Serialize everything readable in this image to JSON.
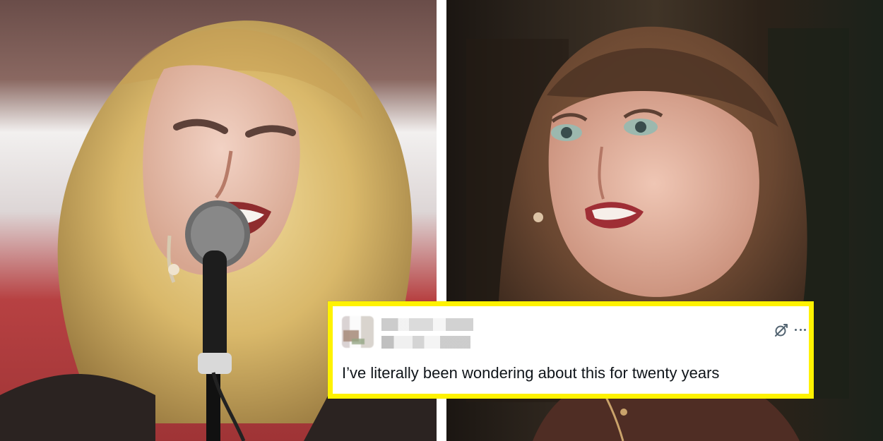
{
  "tweet": {
    "text": "I’ve literally been wondering about this for twenty years"
  },
  "colors": {
    "highlight": "#fff200",
    "text": "#0f1419",
    "icon": "#536471"
  },
  "icons": {
    "grok": "grok-icon",
    "more": "more-options-icon"
  }
}
